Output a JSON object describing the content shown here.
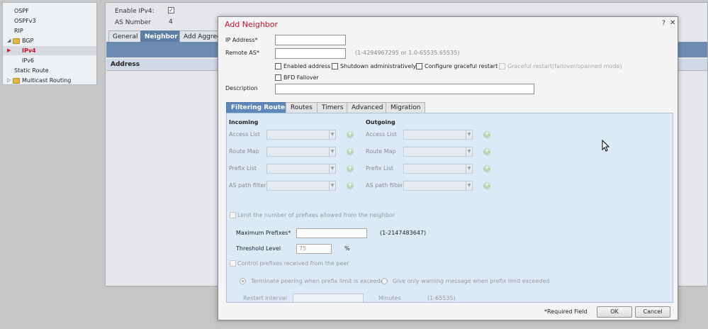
{
  "tree": {
    "items": [
      {
        "label": "OSPF"
      },
      {
        "label": "OSPFv3"
      },
      {
        "label": "RIP"
      },
      {
        "label": "BGP"
      },
      {
        "label": "IPv4"
      },
      {
        "label": "IPv6"
      },
      {
        "label": "Static Route"
      },
      {
        "label": "Multicast Routing"
      }
    ]
  },
  "background": {
    "enable_ipv4_label": "Enable IPv4:",
    "as_number_label": "AS Number",
    "as_number_value": "4",
    "tabs": [
      "General",
      "Neighbor",
      "Add Aggreg"
    ],
    "address_header": "Address"
  },
  "dialog": {
    "title": "Add Neighbor",
    "help": "?",
    "close": "✕",
    "ip_address_label": "IP Address*",
    "remote_as_label": "Remote AS*",
    "remote_as_hint": "(1-4294967295 or 1.0-65535.65535)",
    "checkboxes": {
      "enabled_address": "Enabled address",
      "shutdown": "Shutdown administratively",
      "graceful": "Configure graceful restart",
      "graceful_mode": "Graceful restart(failover/spanned mode)",
      "bfd": "BFD Fallover"
    },
    "description_label": "Description",
    "tabs": [
      "Filtering Routes",
      "Routes",
      "Timers",
      "Advanced",
      "Migration"
    ],
    "incoming": {
      "title": "Incoming",
      "rows": [
        "Access List",
        "Route Map",
        "Prefix List",
        "AS path filter"
      ]
    },
    "outgoing": {
      "title": "Outgoing",
      "rows": [
        "Access List",
        "Route Map",
        "Prefix List",
        "AS path filter"
      ]
    },
    "limit_prefixes_label": "Limit the number of prefixes allowed from the neighbor",
    "max_prefixes_label": "Maximum Prefixes*",
    "max_prefixes_hint": "(1-2147483647)",
    "threshold_label": "Threshold Level",
    "threshold_value": "75",
    "threshold_unit": "%",
    "control_prefixes_label": "Control prefixes received from the peer",
    "radio_terminate": "Terminate peering when prefix limit is exceeded",
    "radio_warning": "Give only warning message when prefix limit exceeded",
    "restart_interval_label": "Restart interval",
    "restart_unit": "Minutes",
    "restart_hint": "(1-65535)",
    "required_field": "*Required Field",
    "ok_label": "OK",
    "cancel_label": "Cancel"
  },
  "colors": {
    "title_red": "#c8102e",
    "active_tab": "#5e87b9",
    "panel_bg": "#dceaf8"
  }
}
